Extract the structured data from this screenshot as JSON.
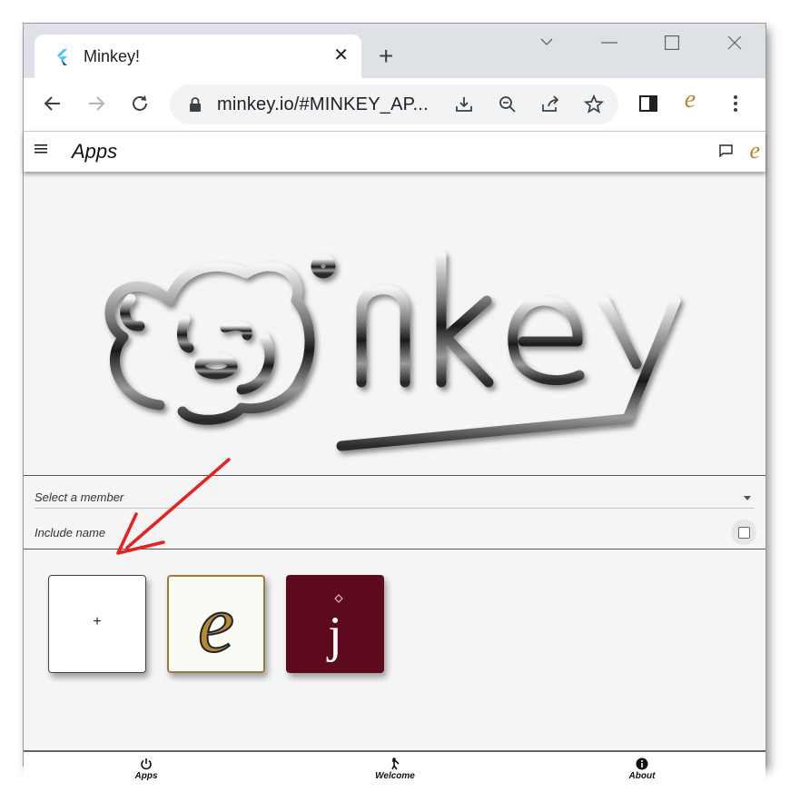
{
  "browser": {
    "tab_title": "Minkey!",
    "url": "minkey.io/#MINKEY_AP...",
    "new_tab_label": "+",
    "tab_close": "✕"
  },
  "app": {
    "title": "Apps",
    "logo_text": "minkey",
    "select_label": "Select a member",
    "include_label": "Include name",
    "include_checked": false,
    "add_tile_label": "+",
    "tile_e_letter": "e",
    "tile_j_letter": "j"
  },
  "bottom_nav": [
    {
      "label": "Apps",
      "icon": "power-icon"
    },
    {
      "label": "Welcome",
      "icon": "person-icon"
    },
    {
      "label": "About",
      "icon": "info-icon"
    }
  ],
  "colors": {
    "accent_arrow": "#e82020",
    "tile_j_bg": "#5e0a1e",
    "e_gold": "#b7892d"
  }
}
